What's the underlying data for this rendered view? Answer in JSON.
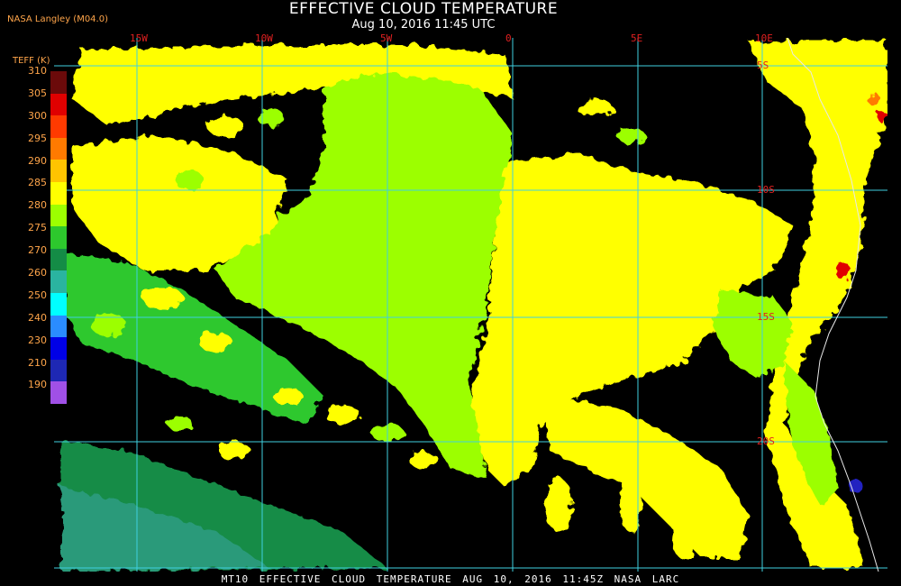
{
  "header": {
    "title": "EFFECTIVE CLOUD TEMPERATURE",
    "subtitle": "Aug 10, 2016 11:45 UTC",
    "org": "NASA Langley (M04.0)"
  },
  "footer": {
    "text": "MT10  EFFECTIVE CLOUD TEMPERATURE   AUG 10, 2016 11:45Z   NASA LARC"
  },
  "color_scale": {
    "title": "TEFF (K)",
    "labels": [
      "310",
      "305",
      "300",
      "295",
      "290",
      "285",
      "280",
      "275",
      "270",
      "260",
      "250",
      "240",
      "230",
      "210",
      "190"
    ],
    "colors": [
      "#6b0a0a",
      "#e00000",
      "#ff3a00",
      "#ff7a00",
      "#ffc400",
      "#ffff00",
      "#9cff00",
      "#2dc82d",
      "#148c46",
      "#2ab4a0",
      "#00ffff",
      "#2a8cff",
      "#0000e6",
      "#1e28b4",
      "#a050e6"
    ]
  },
  "grid": {
    "lon_labels": [
      "15W",
      "10W",
      "5W",
      "0",
      "5E",
      "10E"
    ],
    "lat_labels": [
      "5S",
      "10S",
      "15S",
      "20S"
    ],
    "line_color": "#3fd0e0"
  },
  "palette": {
    "yellow": "#ffff00",
    "light_green": "#9cff00",
    "green": "#2dc82d",
    "dark_green": "#148c46",
    "teal": "#2a9a7a",
    "orange": "#ff7a00",
    "red": "#e00000",
    "blue": "#2020c0",
    "coast": "#e8e8e8"
  }
}
